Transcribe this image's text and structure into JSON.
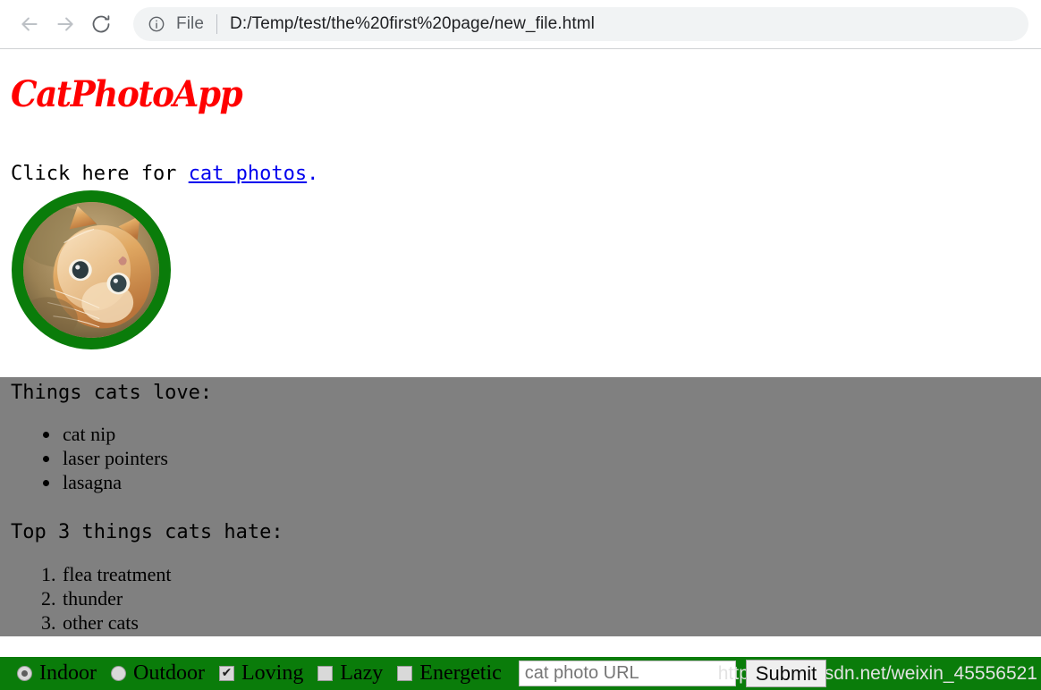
{
  "browser": {
    "back_icon": "arrow-left-icon",
    "forward_icon": "arrow-right-icon",
    "reload_icon": "reload-icon",
    "site_info_icon": "info-circle-icon",
    "scheme_label": "File",
    "url": "D:/Temp/test/the%20first%20page/new_file.html"
  },
  "page": {
    "title": "CatPhotoApp",
    "title_color": "#ff0000",
    "intro": {
      "prefix": "Click here for ",
      "link_text": "cat photos",
      "suffix": ".",
      "link_color": "#0000ee"
    },
    "cat_image": {
      "alt": "cat-photo",
      "border_color": "#0a7c0a"
    },
    "panel": {
      "background": "#808080",
      "love_heading": "Things cats love:",
      "love_items": [
        "cat nip",
        "laser pointers",
        "lasagna"
      ],
      "hate_heading": "Top 3 things cats hate:",
      "hate_items": [
        "flea treatment",
        "thunder",
        "other cats"
      ]
    },
    "form": {
      "background": "#0a7c0a",
      "radios": [
        {
          "label": "Indoor",
          "checked": true
        },
        {
          "label": "Outdoor",
          "checked": false
        }
      ],
      "checkboxes": [
        {
          "label": "Loving",
          "checked": true
        },
        {
          "label": "Lazy",
          "checked": false
        },
        {
          "label": "Energetic",
          "checked": false
        }
      ],
      "url_placeholder": "cat photo URL",
      "url_value": "",
      "submit_label": "Submit"
    },
    "watermark": "https://blog.csdn.net/weixin_45556521"
  }
}
